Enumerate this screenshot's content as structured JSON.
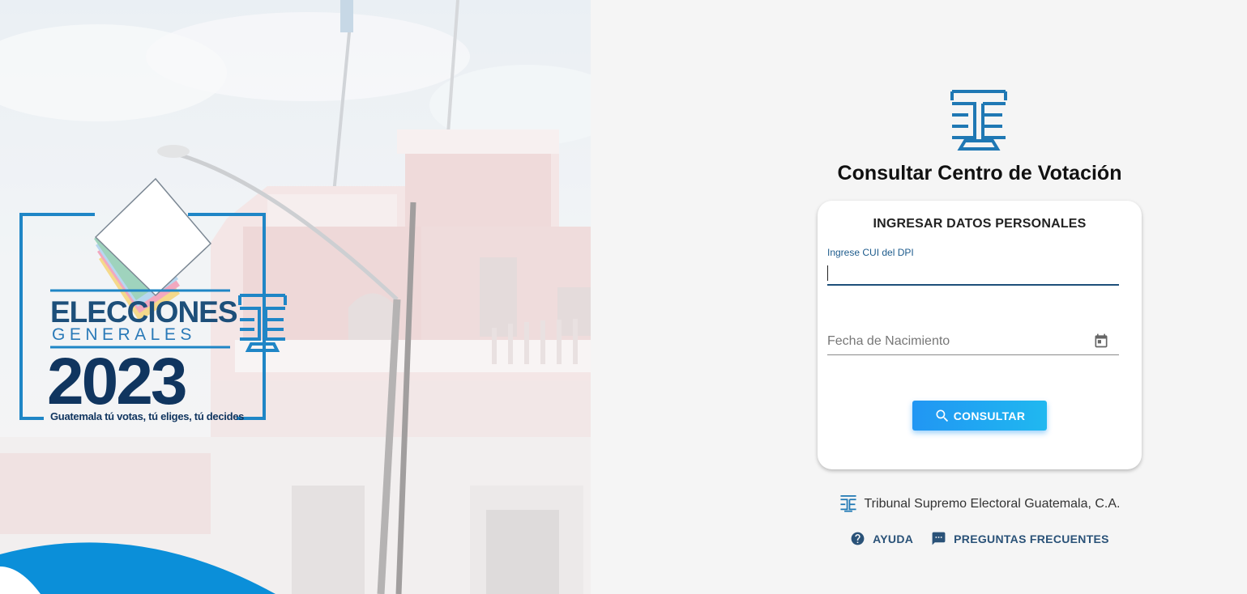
{
  "hero": {
    "title_line1": "ELECCIONES",
    "title_line2": "GENERALES",
    "year": "2023",
    "slogan": "Guatemala tú votas, tú eliges, tú decides"
  },
  "page": {
    "title": "Consultar Centro de Votación"
  },
  "card": {
    "heading": "INGRESAR DATOS PERSONALES",
    "cui_label": "Ingrese CUI del DPI",
    "cui_value": "",
    "date_placeholder": "Fecha de Nacimiento",
    "submit_label": "CONSULTAR"
  },
  "footer": {
    "org_name": "Tribunal Supremo Electoral Guatemala, C.A.",
    "help_label": "AYUDA",
    "faq_label": "PREGUNTAS FRECUENTES"
  },
  "icons": {
    "search": "search-icon",
    "calendar": "calendar-icon",
    "help": "help-circle-icon",
    "faq": "chat-icon",
    "logo": "tse-logo-icon"
  },
  "colors": {
    "accent": "#2196f3",
    "brand_dark": "#1d4f7a",
    "brand_blue": "#1f78b4",
    "background": "#f5f5f5"
  }
}
